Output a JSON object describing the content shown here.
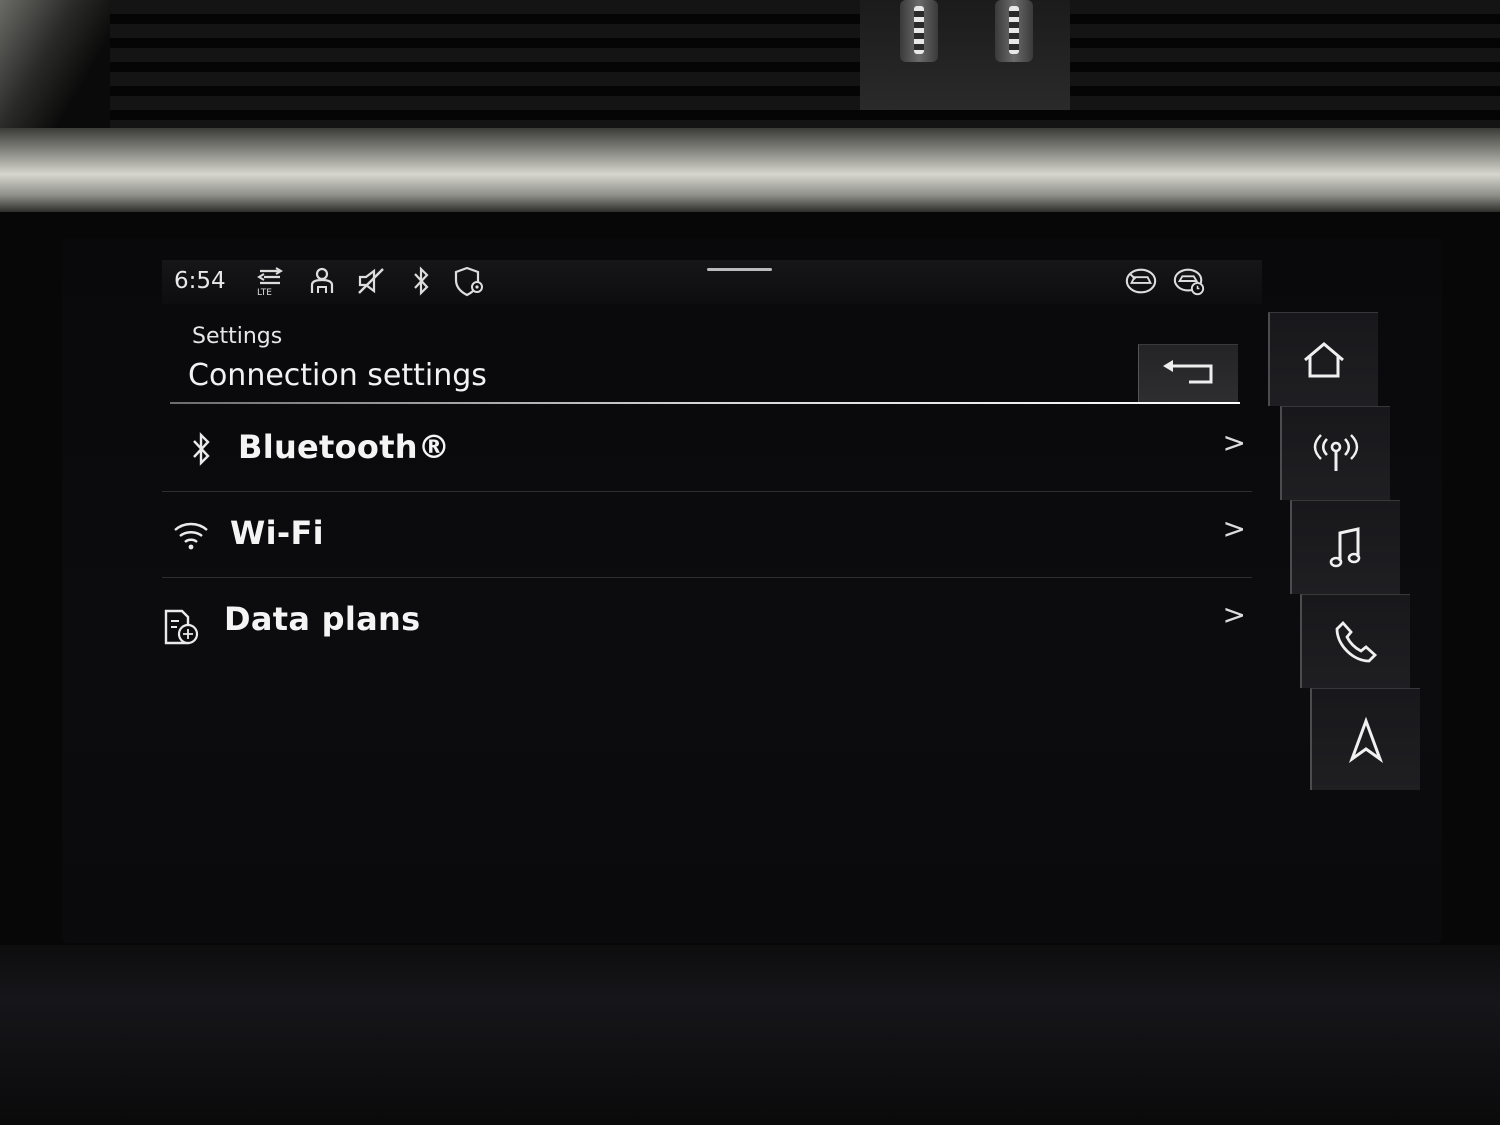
{
  "status_bar": {
    "time": "6:54",
    "icons": [
      "lte-data-icon",
      "profile-icon",
      "mute-icon",
      "bluetooth-icon",
      "location-shield-icon",
      "car-connect-icon",
      "car-timer-icon"
    ],
    "lte_label": "LTE"
  },
  "header": {
    "breadcrumb": "Settings",
    "title": "Connection settings",
    "back_icon": "back-arrow-icon"
  },
  "list": {
    "items": [
      {
        "label": "Bluetooth®",
        "icon": "bluetooth-icon",
        "chevron": ">"
      },
      {
        "label": "Wi-Fi",
        "icon": "wifi-icon",
        "chevron": ">"
      },
      {
        "label": "Data plans",
        "icon": "data-plan-icon",
        "chevron": ">"
      }
    ]
  },
  "rail": {
    "buttons": [
      "home-icon",
      "radio-icon",
      "music-icon",
      "phone-icon",
      "navigation-icon"
    ]
  }
}
